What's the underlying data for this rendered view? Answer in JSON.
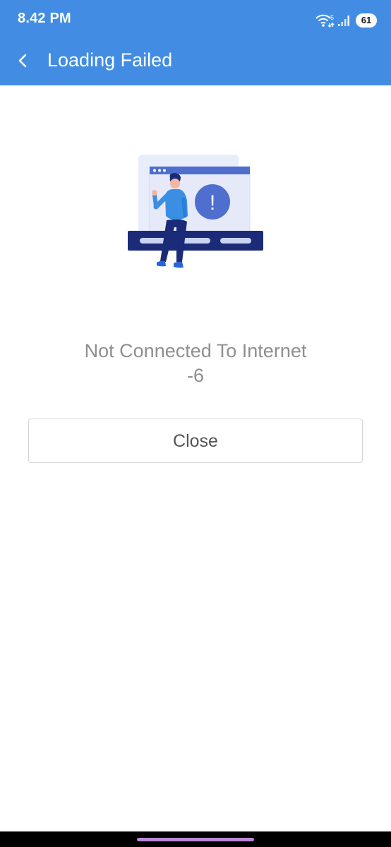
{
  "status_bar": {
    "time": "8.42 PM",
    "wifi_badge": "5",
    "battery": "61"
  },
  "header": {
    "title": "Loading Failed",
    "background_color": "#428de3",
    "back_icon": "chevron-left-icon"
  },
  "illustration": {
    "alert_symbol": "!",
    "description_icon": "person-at-browser-error-illustration"
  },
  "message": {
    "text": "Not Connected To Internet",
    "code": "-6"
  },
  "close_button": {
    "label": "Close"
  },
  "nav_bar": {
    "indicator_color": "#b989d6"
  }
}
